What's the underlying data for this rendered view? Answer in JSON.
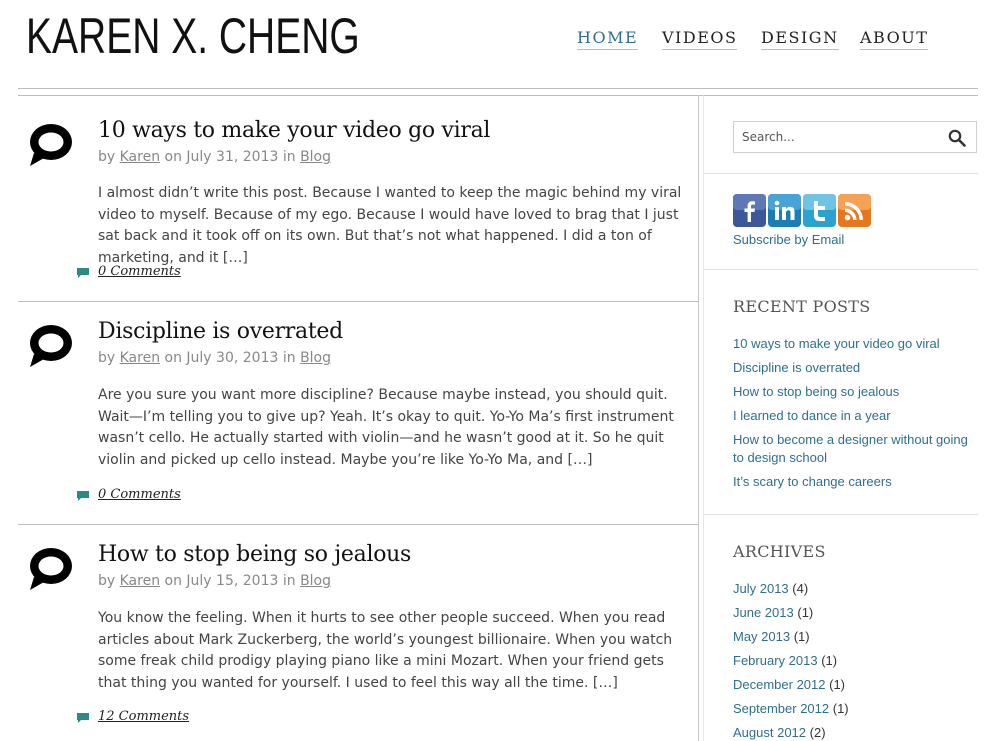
{
  "site": {
    "title": "KAREN X. CHENG"
  },
  "nav": [
    {
      "label": "HOME",
      "active": true
    },
    {
      "label": "VIDEOS"
    },
    {
      "label": "DESIGN"
    },
    {
      "label": "ABOUT"
    }
  ],
  "posts": [
    {
      "title": "10 ways to make your video go viral",
      "by": "by",
      "author": "Karen",
      "on": "on July 31, 2013 in",
      "category": "Blog",
      "excerpt": "I almost didn’t write this post. Because I wanted to keep the magic behind my viral video to myself. Because of my ego. Because I would have loved to brag that I just sat back and it took off on its own. But that’s not what happened. I did a ton of marketing, and it […]",
      "comments": "0 Comments"
    },
    {
      "title": "Discipline is overrated",
      "by": "by",
      "author": "Karen",
      "on": "on July 30, 2013 in",
      "category": "Blog",
      "excerpt": "Are you sure you want more discipline? Because maybe instead, you should quit. Wait—I’m telling you to give up? Yeah. It’s okay to quit. Yo-Yo Ma’s first instrument wasn’t cello. He actually started with violin—and he wasn’t good at it. So he quit violin and picked up cello instead. Maybe you’re like Yo-Yo Ma, and […]",
      "comments": "0 Comments"
    },
    {
      "title": "How to stop being so jealous",
      "by": "by",
      "author": "Karen",
      "on": "on July 15, 2013 in",
      "category": "Blog",
      "excerpt": "You know the feeling. When it hurts to see other people succeed. When you read articles about Mark Zuckerberg, the world’s youngest billionaire. When you watch some freak child prodigy playing piano like a mini Mozart. When your friend gets that thing you wanted for yourself. I used to feel this way all the time. […]",
      "comments": "12 Comments"
    }
  ],
  "sidebar": {
    "search_placeholder": "Search...",
    "social_icons": [
      "facebook-icon",
      "linkedin-icon",
      "twitter-icon",
      "rss-icon"
    ],
    "subscribe_label": "Subscribe by Email",
    "recent_title": "RECENT POSTS",
    "recent": [
      "10 ways to make your video go viral",
      "Discipline is overrated",
      "How to stop being so jealous",
      "I learned to dance in a year",
      "How to become a designer without going to design school",
      "It’s scary to change careers"
    ],
    "archives_title": "ARCHIVES",
    "archives": [
      {
        "label": "July 2013",
        "count": "(4)"
      },
      {
        "label": "June 2013",
        "count": "(1)"
      },
      {
        "label": "May 2013",
        "count": "(1)"
      },
      {
        "label": "February 2013",
        "count": "(1)"
      },
      {
        "label": "December 2012",
        "count": "(1)"
      },
      {
        "label": "September 2012",
        "count": "(1)"
      },
      {
        "label": "August 2012",
        "count": "(2)"
      }
    ]
  },
  "colors": {
    "link": "#2e6f8e",
    "comment_icon": "#2b8a86"
  }
}
